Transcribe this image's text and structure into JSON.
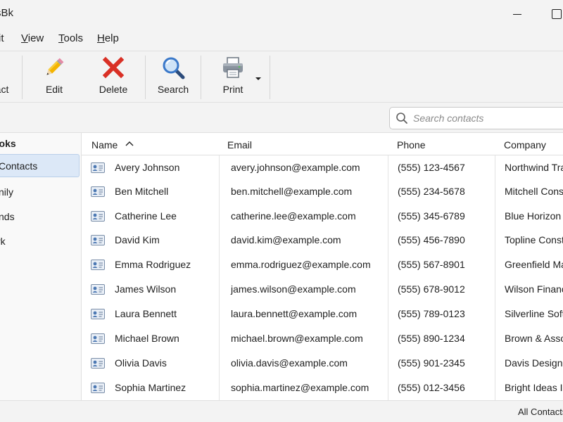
{
  "window": {
    "title": "sBk"
  },
  "menu": {
    "items": [
      {
        "label": "it",
        "underline": ""
      },
      {
        "label": "View",
        "underline": "V"
      },
      {
        "label": "Tools",
        "underline": "T"
      },
      {
        "label": "Help",
        "underline": "H"
      }
    ]
  },
  "toolbar": {
    "buttons": [
      {
        "label": "act",
        "icon": "new-contact-icon"
      },
      {
        "label": "Edit",
        "icon": "pencil-icon"
      },
      {
        "label": "Delete",
        "icon": "delete-x-icon"
      },
      {
        "label": "Search",
        "icon": "magnifier-icon"
      },
      {
        "label": "Print",
        "icon": "printer-icon"
      }
    ]
  },
  "search": {
    "placeholder": "Search contacts",
    "value": ""
  },
  "sidebar": {
    "header": "ooks",
    "items": [
      {
        "label": "Contacts",
        "selected": true
      },
      {
        "label": "nily",
        "selected": false
      },
      {
        "label": "nds",
        "selected": false
      },
      {
        "label": "rk",
        "selected": false
      }
    ]
  },
  "table": {
    "columns": [
      "Name",
      "Email",
      "Phone",
      "Company"
    ],
    "sorted_column": "Name",
    "sort_direction": "ascending",
    "rows": [
      {
        "name": "Avery Johnson",
        "email": "avery.johnson@example.com",
        "phone": "(555) 123-4567",
        "company": "Northwind Tra"
      },
      {
        "name": "Ben Mitchell",
        "email": "ben.mitchell@example.com",
        "phone": "(555) 234-5678",
        "company": "Mitchell Cons"
      },
      {
        "name": "Catherine Lee",
        "email": "catherine.lee@example.com",
        "phone": "(555) 345-6789",
        "company": "Blue Horizon"
      },
      {
        "name": "David Kim",
        "email": "david.kim@example.com",
        "phone": "(555) 456-7890",
        "company": "Topline Const"
      },
      {
        "name": "Emma Rodriguez",
        "email": "emma.rodriguez@example.com",
        "phone": "(555) 567-8901",
        "company": "Greenfield Ma"
      },
      {
        "name": "James Wilson",
        "email": "james.wilson@example.com",
        "phone": "(555) 678-9012",
        "company": "Wilson Financ"
      },
      {
        "name": "Laura Bennett",
        "email": "laura.bennett@example.com",
        "phone": "(555) 789-0123",
        "company": "Silverline Soft"
      },
      {
        "name": "Michael Brown",
        "email": "michael.brown@example.com",
        "phone": "(555) 890-1234",
        "company": "Brown & Asso"
      },
      {
        "name": "Olivia Davis",
        "email": "olivia.davis@example.com",
        "phone": "(555) 901-2345",
        "company": "Davis Design S"
      },
      {
        "name": "Sophia Martinez",
        "email": "sophia.martinez@example.com",
        "phone": "(555) 012-3456",
        "company": "Bright Ideas In"
      }
    ]
  },
  "status": {
    "text": "All Contacts"
  },
  "colors": {
    "chrome": "#f3f3f3",
    "selection": "#dce8f7",
    "delete_red": "#d93025",
    "accent_blue": "#3a78c9"
  }
}
